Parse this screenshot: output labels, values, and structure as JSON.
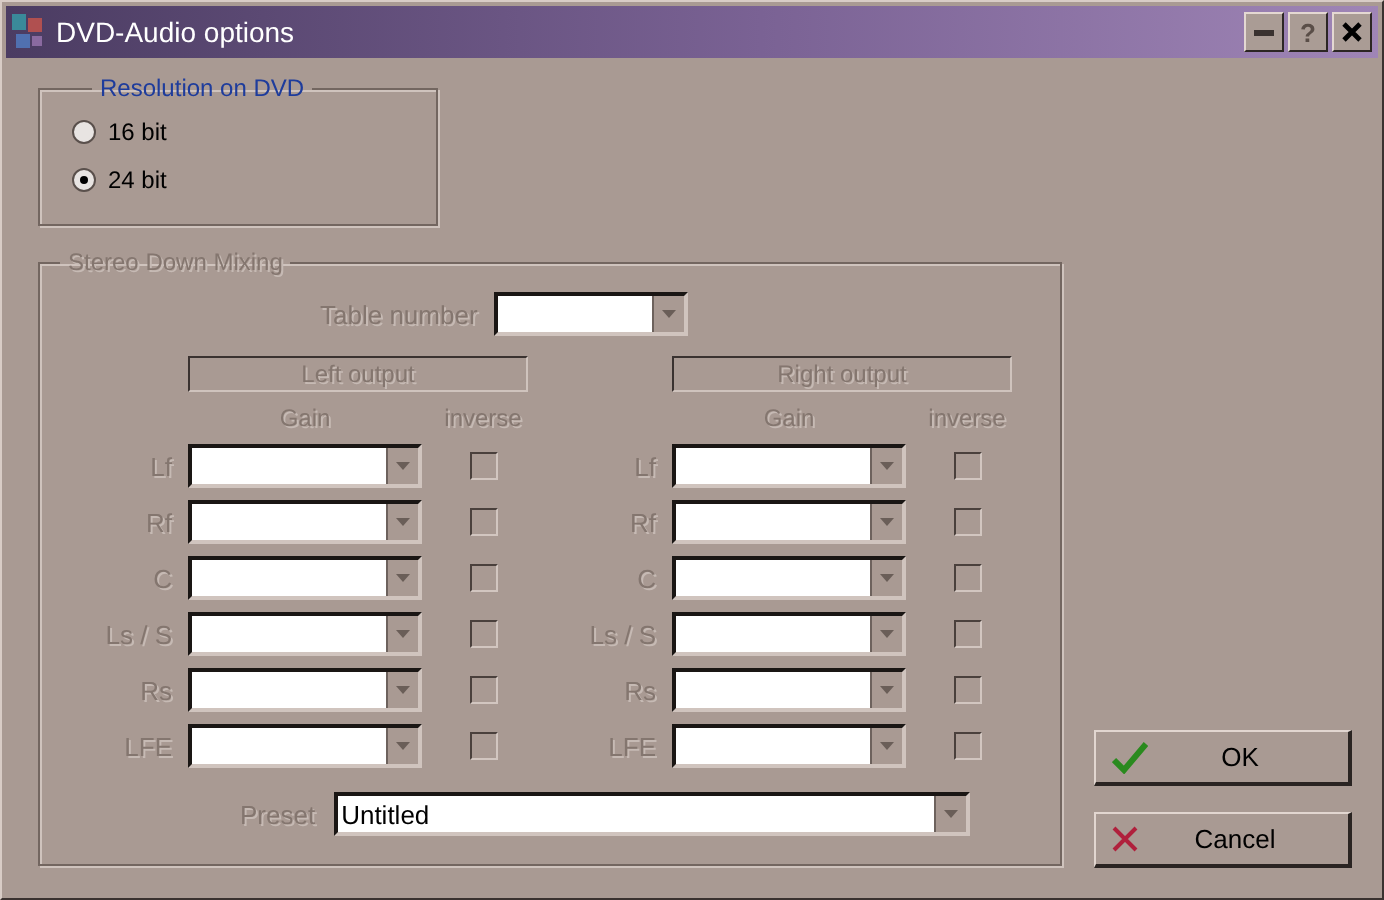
{
  "window": {
    "title": "DVD-Audio options",
    "title_buttons": [
      {
        "kind": "minimize"
      },
      {
        "kind": "help",
        "label": "?"
      },
      {
        "kind": "close"
      }
    ]
  },
  "resolution": {
    "title": "Resolution on DVD",
    "options": [
      {
        "label": "16 bit",
        "selected": false
      },
      {
        "label": "24 bit",
        "selected": true
      }
    ]
  },
  "downmix": {
    "title": "Stereo Down Mixing",
    "disabled": true,
    "table_number": {
      "label": "Table number"
    },
    "outputs": [
      {
        "title": "Left output",
        "gain_header": "Gain",
        "inverse_header": "inverse",
        "channels": [
          {
            "label": "Lf",
            "checked": false
          },
          {
            "label": "Rf",
            "checked": false
          },
          {
            "label": "C",
            "checked": false
          },
          {
            "label": "Ls / S",
            "checked": false
          },
          {
            "label": "Rs",
            "checked": false
          },
          {
            "label": "LFE",
            "checked": false
          }
        ]
      },
      {
        "title": "Right output",
        "gain_header": "Gain",
        "inverse_header": "inverse",
        "channels": [
          {
            "label": "Lf",
            "checked": false
          },
          {
            "label": "Rf",
            "checked": false
          },
          {
            "label": "C",
            "checked": false
          },
          {
            "label": "Ls / S",
            "checked": false
          },
          {
            "label": "Rs",
            "checked": false
          },
          {
            "label": "LFE",
            "checked": false
          }
        ]
      }
    ],
    "preset": {
      "label": "Preset",
      "value": "Untitled"
    }
  },
  "buttons": [
    {
      "kind": "ok",
      "label": "OK"
    },
    {
      "kind": "cancel",
      "label": "Cancel"
    }
  ]
}
